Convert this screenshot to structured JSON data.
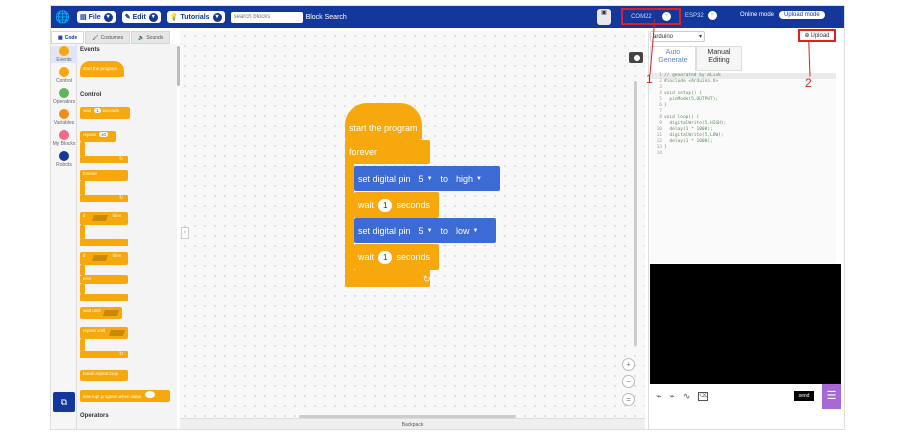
{
  "menubar": {
    "file_label": "File",
    "edit_label": "Edit",
    "tutorials_label": "Tutorials",
    "search_placeholder": "search blocks",
    "search_button": "Block Search",
    "port_label": "COM22",
    "board_label": "ESP32",
    "online_mode_label": "Online mode",
    "upload_mode_label": "Upload mode"
  },
  "tabs": {
    "code_label": "Code",
    "costumes_label": "Costumes",
    "sounds_label": "Sounds"
  },
  "categories": [
    {
      "label": "Events",
      "color": "#f7a80c"
    },
    {
      "label": "Control",
      "color": "#f7a80c"
    },
    {
      "label": "Operators",
      "color": "#5cb85c"
    },
    {
      "label": "Variables",
      "color": "#f08c1a"
    },
    {
      "label": "My Blocks",
      "color": "#f06a8a"
    },
    {
      "label": "Robots",
      "color": "#13379b"
    }
  ],
  "palette": {
    "events_heading": "Events",
    "start_block": "start the program",
    "control_heading": "Control",
    "wait_block": "wait",
    "wait_value": "1",
    "wait_unit": "seconds",
    "repeat_block": "repeat",
    "repeat_value": "10",
    "forever_block": "forever",
    "if_then_if": "if",
    "if_then_then": "then",
    "if_else_if": "if",
    "if_else_then": "then",
    "if_else_else": "else",
    "wait_until_block": "wait until",
    "repeat_until_block": "repeat until",
    "break_block": "break repeat loop",
    "interrupt_block": "interrupt program when value",
    "operators_heading": "Operators"
  },
  "workspace": {
    "hat_label": "start the program",
    "forever_label": "forever",
    "block1": {
      "text": "set digital pin",
      "pin": "5",
      "to": "to",
      "value": "high"
    },
    "block2": {
      "text": "wait",
      "value": "1",
      "unit": "seconds"
    },
    "block3": {
      "text": "set digital pin",
      "pin": "5",
      "to": "to",
      "value": "low"
    },
    "block4": {
      "text": "wait",
      "value": "1",
      "unit": "seconds"
    },
    "backpack_label": "Backpack",
    "zoom_in": "+",
    "zoom_out": "−",
    "zoom_reset": "="
  },
  "right": {
    "board_select": "arduino",
    "upload_label": "Upload",
    "tab_auto": "Auto Generate",
    "tab_manual": "Manual Editing",
    "code_lines": [
      "// generated by mLink",
      "#include <Arduino.h>",
      "",
      "void setup() {",
      "  pinMode(5,OUTPUT);",
      "}",
      "",
      "void loop() {",
      "  digitalWrite(5,HIGH);",
      "  delay(1 * 1000);",
      "  digitalWrite(5,LOW);",
      "  delay(1 * 1000);",
      "}",
      ""
    ],
    "send_label": "send"
  },
  "annotations": {
    "marker1": "1",
    "marker2": "2"
  },
  "colors": {
    "menubar": "#13379b",
    "event_block": "#f7a80c",
    "pin_block": "#3d6bd6",
    "highlight": "#e02020"
  }
}
